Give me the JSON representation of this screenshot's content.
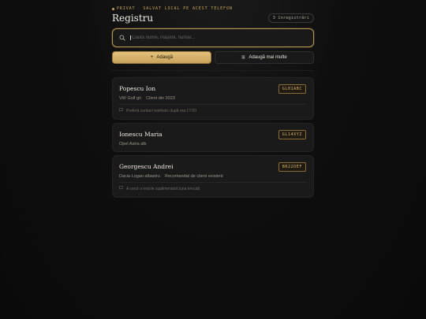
{
  "header": {
    "eyebrow_a": "PRIVAT",
    "eyebrow_sep": "·",
    "eyebrow_b": "SALVAT LOCAL PE ACEST TELEFON",
    "title": "Registru",
    "count_badge": "3 înregistrări"
  },
  "search": {
    "placeholder": "Caută nume, mașină, număr...",
    "value": ""
  },
  "actions": {
    "add_label": "Adaugă",
    "add_icon": "plus-icon",
    "add_more_label": "Adaugă mai multe",
    "add_more_icon": "list-icon"
  },
  "colors": {
    "accent": "#c8a45c",
    "background": "#0b0b0b",
    "card": "#1a1a1a"
  },
  "records": [
    {
      "name": "Popescu Ion",
      "plate": "GL01ABC",
      "car": "VW Golf gri",
      "detail": "Client din 2023",
      "note": "Preferă contact telefonic după ora 17:00",
      "note_icon": "comment-icon"
    },
    {
      "name": "Ionescu Maria",
      "plate": "GL14XYZ",
      "car": "Opel Astra alb",
      "detail": "",
      "note": ""
    },
    {
      "name": "Georgescu Andrei",
      "plate": "BR22DEF",
      "car": "Dacia Logan albastru",
      "detail": "Recomandat de client existent",
      "note": "A cerut o revizie suplimentară luna trecută",
      "note_icon": "comment-icon"
    }
  ]
}
